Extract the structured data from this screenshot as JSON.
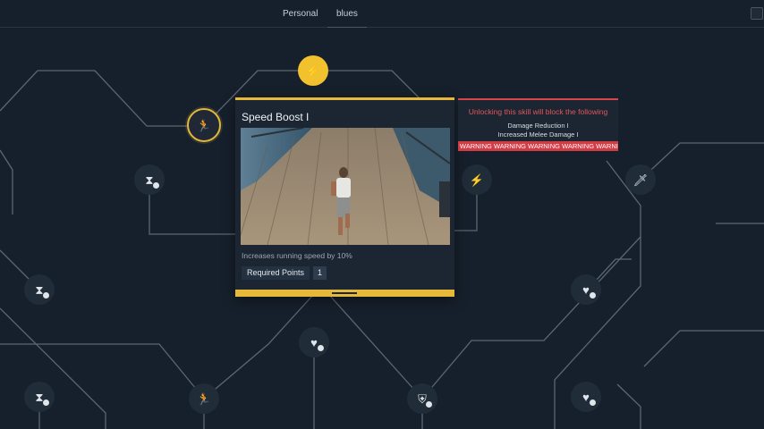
{
  "tabs": [
    {
      "label": "Personal",
      "active": false
    },
    {
      "label": "blues",
      "active": true
    }
  ],
  "colors": {
    "background": "#16202c",
    "line": "#5b6670",
    "accent_gold": "#f2c12e",
    "warning_red": "#d33c44",
    "node_fill": "#212c39"
  },
  "nodes": {
    "top_gold": {
      "icon": "lightning-icon",
      "state": "highlighted"
    },
    "selected": {
      "icon": "running-man-icon",
      "state": "selected"
    },
    "left_hourglass": {
      "icon": "hourglass-icon"
    },
    "mid_lightning": {
      "icon": "lightning-icon"
    },
    "right_sword": {
      "icon": "sword-icon"
    },
    "left_lower_hourglass": {
      "icon": "hourglass-icon"
    },
    "right_heart": {
      "icon": "heart-plus-icon"
    },
    "center_heart": {
      "icon": "heart-plus-icon"
    },
    "bottom_hourglass": {
      "icon": "hourglass-icon"
    },
    "bottom_runner": {
      "icon": "running-man-icon"
    },
    "bottom_shield": {
      "icon": "shield-icon"
    },
    "bottom_right_heart": {
      "icon": "heart-plus-icon"
    }
  },
  "skill_card": {
    "title": "Speed Boost I",
    "description": "Increases running speed by 10%",
    "required_points_label": "Required Points",
    "required_points_value": "1",
    "image": "player-running-on-boardwalk-image"
  },
  "warning": {
    "title": "Unlocking this skill will block the following",
    "blocked": [
      "Damage Reduction I",
      "Increased Melee Damage I"
    ],
    "ticker": "G WARNING WARNING WARNING WARNING WARNIN"
  }
}
